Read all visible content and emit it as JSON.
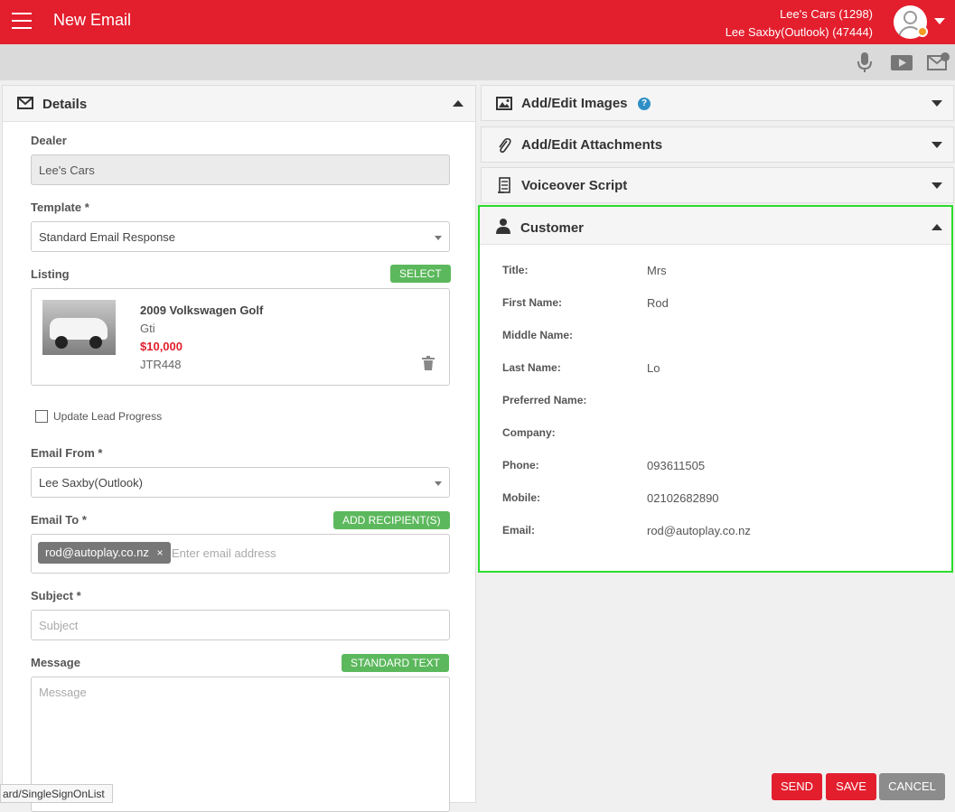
{
  "header": {
    "title": "New Email",
    "dealer_line": "Lee's Cars (1298)",
    "user_line": "Lee Saxby(Outlook) (47444)"
  },
  "details": {
    "title": "Details",
    "dealer_label": "Dealer",
    "dealer_value": "Lee's Cars",
    "template_label": "Template *",
    "template_value": "Standard Email Response",
    "listing_label": "Listing",
    "select_button": "SELECT",
    "listing": {
      "title": "2009 Volkswagen Golf",
      "variant": "Gti",
      "price": "$10,000",
      "code": "JTR448"
    },
    "update_lead_label": "Update Lead Progress",
    "email_from_label": "Email From *",
    "email_from_value": "Lee Saxby(Outlook)",
    "email_to_label": "Email To *",
    "add_recipient_button": "ADD RECIPIENT(S)",
    "recipient_chip": "rod@autoplay.co.nz",
    "chip_remove": "×",
    "email_to_placeholder": "Enter email address",
    "subject_label": "Subject *",
    "subject_placeholder": "Subject",
    "message_label": "Message",
    "standard_text_button": "STANDARD TEXT",
    "message_placeholder": "Message"
  },
  "right_sections": {
    "images": "Add/Edit Images",
    "help": "?",
    "attachments": "Add/Edit Attachments",
    "voiceover": "Voiceover Script"
  },
  "customer": {
    "title": "Customer",
    "rows": [
      {
        "label": "Title:",
        "value": "Mrs"
      },
      {
        "label": "First Name:",
        "value": "Rod"
      },
      {
        "label": "Middle Name:",
        "value": ""
      },
      {
        "label": "Last Name:",
        "value": "Lo"
      },
      {
        "label": "Preferred Name:",
        "value": ""
      },
      {
        "label": "Company:",
        "value": ""
      },
      {
        "label": "Phone:",
        "value": "093611505"
      },
      {
        "label": "Mobile:",
        "value": "02102682890"
      },
      {
        "label": "Email:",
        "value": "rod@autoplay.co.nz"
      }
    ]
  },
  "actions": {
    "send": "SEND",
    "save": "SAVE",
    "cancel": "CANCEL"
  },
  "status_url": "ard/SingleSignOnList",
  "colors": {
    "brand_red": "#e31e2d",
    "green_button": "#5cb85c",
    "cancel_gray": "#8c8c8c",
    "price_red": "#e31e2d",
    "highlight_green": "#2bdc2b"
  }
}
